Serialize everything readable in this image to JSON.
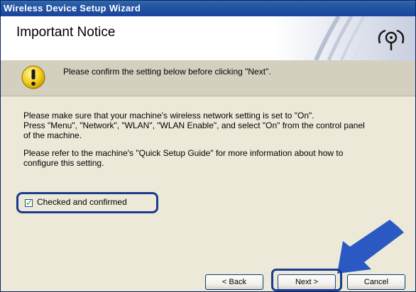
{
  "window": {
    "title": "Wireless Device Setup Wizard"
  },
  "header": {
    "title": "Important Notice",
    "logo_icon": "wireless-signal-icon"
  },
  "notice": {
    "icon": "warning-icon",
    "text": "Please confirm the setting below before clicking \"Next\"."
  },
  "body": {
    "line1": "Please make sure that your machine's wireless network setting is set to \"On\".",
    "line2": "Press \"Menu\", \"Network\", \"WLAN\", \"WLAN Enable\", and select \"On\" from the control panel",
    "line3": "of the machine.",
    "line4": "Please refer to the machine's \"Quick Setup Guide\" for more information about how to",
    "line5": "configure this setting."
  },
  "checkbox": {
    "label": "Checked and confirmed",
    "checked": true
  },
  "buttons": {
    "back": "< Back",
    "next": "Next >",
    "cancel": "Cancel"
  },
  "colors": {
    "titlebar": "#1f4fa0",
    "highlight": "#1b3c8f",
    "arrow": "#2b59c3"
  }
}
